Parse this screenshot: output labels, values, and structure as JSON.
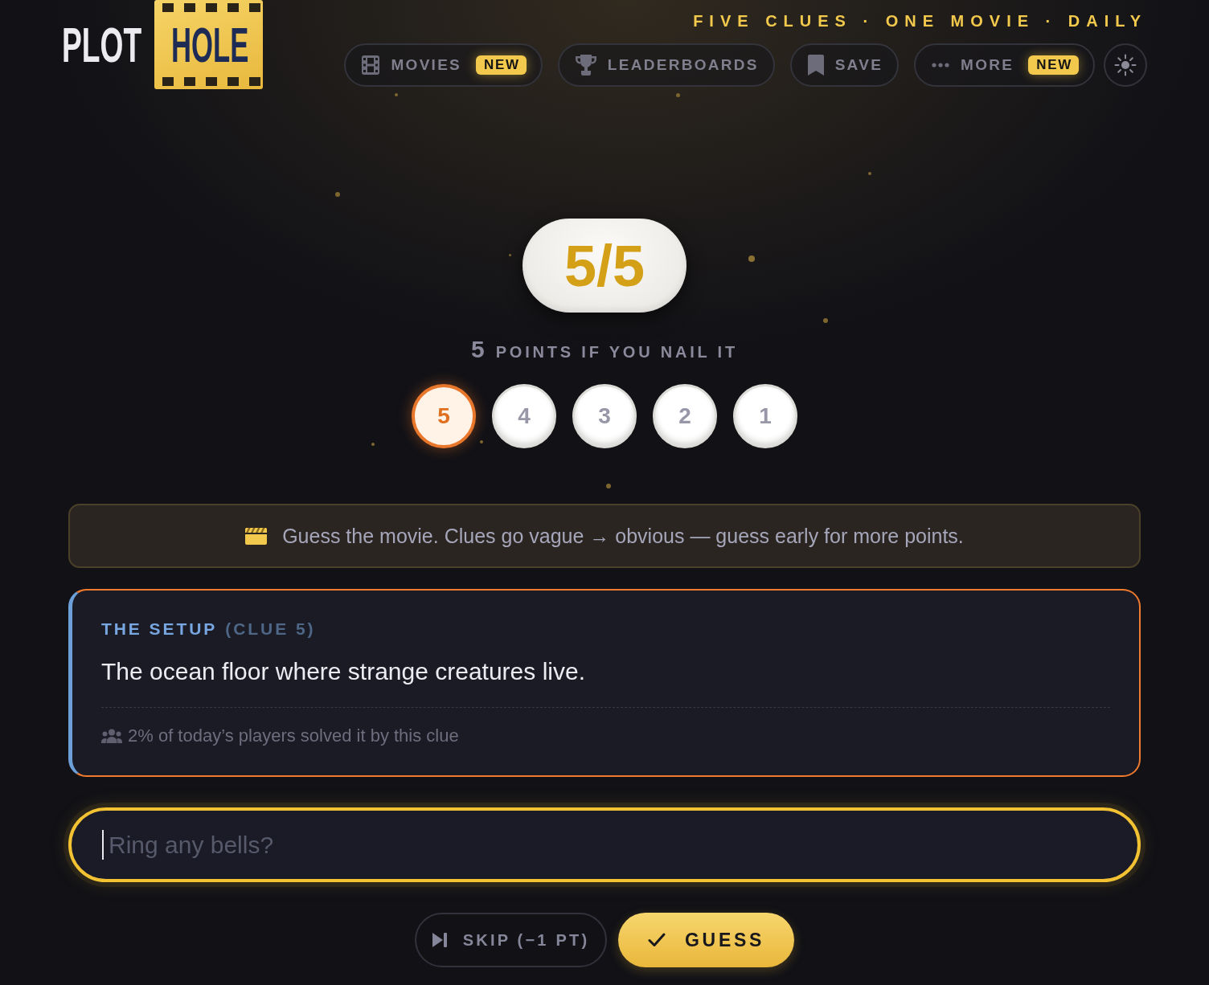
{
  "header": {
    "logo": {
      "word_plain": "PLOT",
      "word_framed": "HOLE"
    },
    "tagline": "FIVE CLUES · ONE MOVIE · DAILY",
    "nav": [
      {
        "kind": "film",
        "label": "MOVIES",
        "badge": "NEW"
      },
      {
        "kind": "trophy",
        "label": "LEADERBOARDS"
      },
      {
        "kind": "bookmark",
        "label": "SAVE"
      },
      {
        "kind": "more",
        "label": "MORE",
        "badge": "NEW"
      }
    ]
  },
  "score": "5/5",
  "points": {
    "value": "5",
    "label": "POINTS IF YOU NAIL IT"
  },
  "clue_steps": [
    {
      "label": "5",
      "selected": true
    },
    {
      "label": "4",
      "selected": false
    },
    {
      "label": "3",
      "selected": false
    },
    {
      "label": "2",
      "selected": false
    },
    {
      "label": "1",
      "selected": false
    }
  ],
  "hint": "Guess the movie. Clues go vague → obvious — guess early for more points.",
  "clue_card": {
    "title": "THE SETUP",
    "subtitle": "(CLUE 5)",
    "text": "The ocean floor where strange creatures live.",
    "stat": "2% of today’s players solved it by this clue"
  },
  "guess_input": {
    "placeholder": "Ring any bells?"
  },
  "actions": [
    {
      "kind": "skip",
      "label": "SKIP (−1 PT)"
    },
    {
      "kind": "guess",
      "label": "GUESS"
    }
  ]
}
